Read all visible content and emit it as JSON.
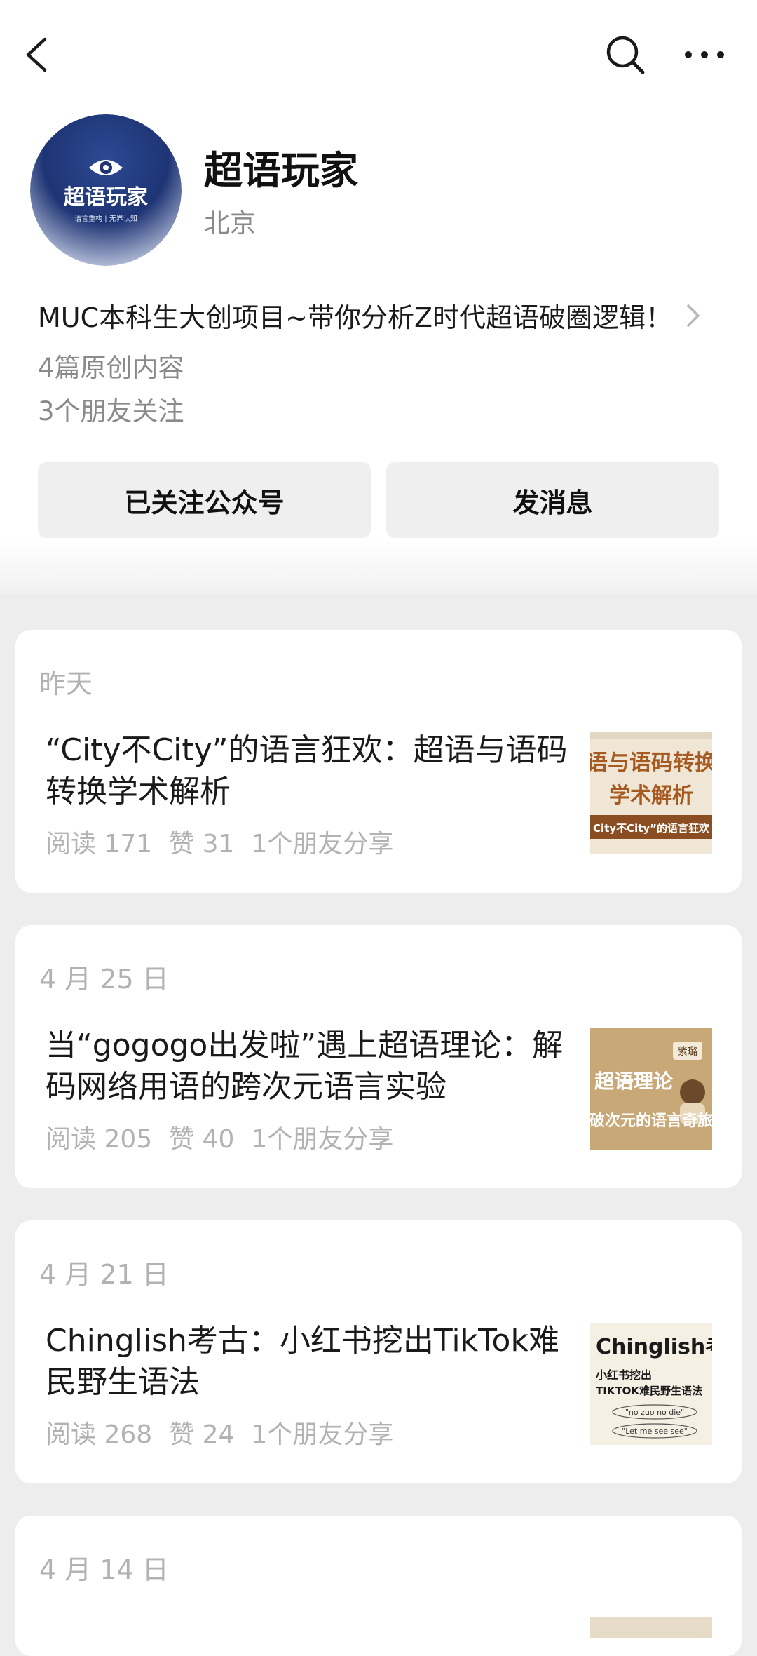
{
  "account": {
    "name": "超语玩家",
    "location": "北京",
    "bio": "MUC本科生大创项目~带你分析Z时代超语破圈逻辑！",
    "original_count": "4篇原创内容",
    "friends_following": "3个朋友关注",
    "avatar_logo_text": "超语玩家",
    "avatar_tagline": "语言重构 | 无界认知"
  },
  "actions": {
    "follow_label": "已关注公众号",
    "message_label": "发消息"
  },
  "articles": [
    {
      "date": "昨天",
      "title": "“City不City”的语言狂欢：超语与语码转换学术解析",
      "read": "阅读 171",
      "likes": "赞 31",
      "shares": "1个朋友分享",
      "thumb_line1": "语与语码转换",
      "thumb_line2": "学术解析",
      "thumb_line3": "City不City”的语言狂欢"
    },
    {
      "date": "4 月 25 日",
      "title": "当“gogogo出发啦”遇上超语理论：解码网络用语的跨次元语言实验",
      "read": "阅读 205",
      "likes": "赞 40",
      "shares": "1个朋友分享",
      "thumb_tag": "紫璐",
      "thumb_line1": "超语理论",
      "thumb_line2": "破次元的语言奇旅"
    },
    {
      "date": "4 月 21 日",
      "title": "Chinglish考古：小红书挖出TikTok难民野生语法",
      "read": "阅读 268",
      "likes": "赞 24",
      "shares": "1个朋友分享",
      "thumb_line1": "Chinglish考古",
      "thumb_line2": "小红书挖出",
      "thumb_line3": "TIKTOK难民野生语法",
      "thumb_line4": "\"no zuo no die\"",
      "thumb_line5": "\"Let me see see\""
    },
    {
      "date": "4 月 14 日"
    }
  ],
  "icons": {
    "back": "back-chevron-icon",
    "search": "search-icon",
    "more": "more-dots-icon",
    "bio_arrow": "chevron-right-icon"
  },
  "colors": {
    "page_bg": "#ededed",
    "card_bg": "#ffffff",
    "muted_text": "#b2b2b2",
    "button_bg": "#efefef",
    "avatar_navy": "#1f3777"
  }
}
